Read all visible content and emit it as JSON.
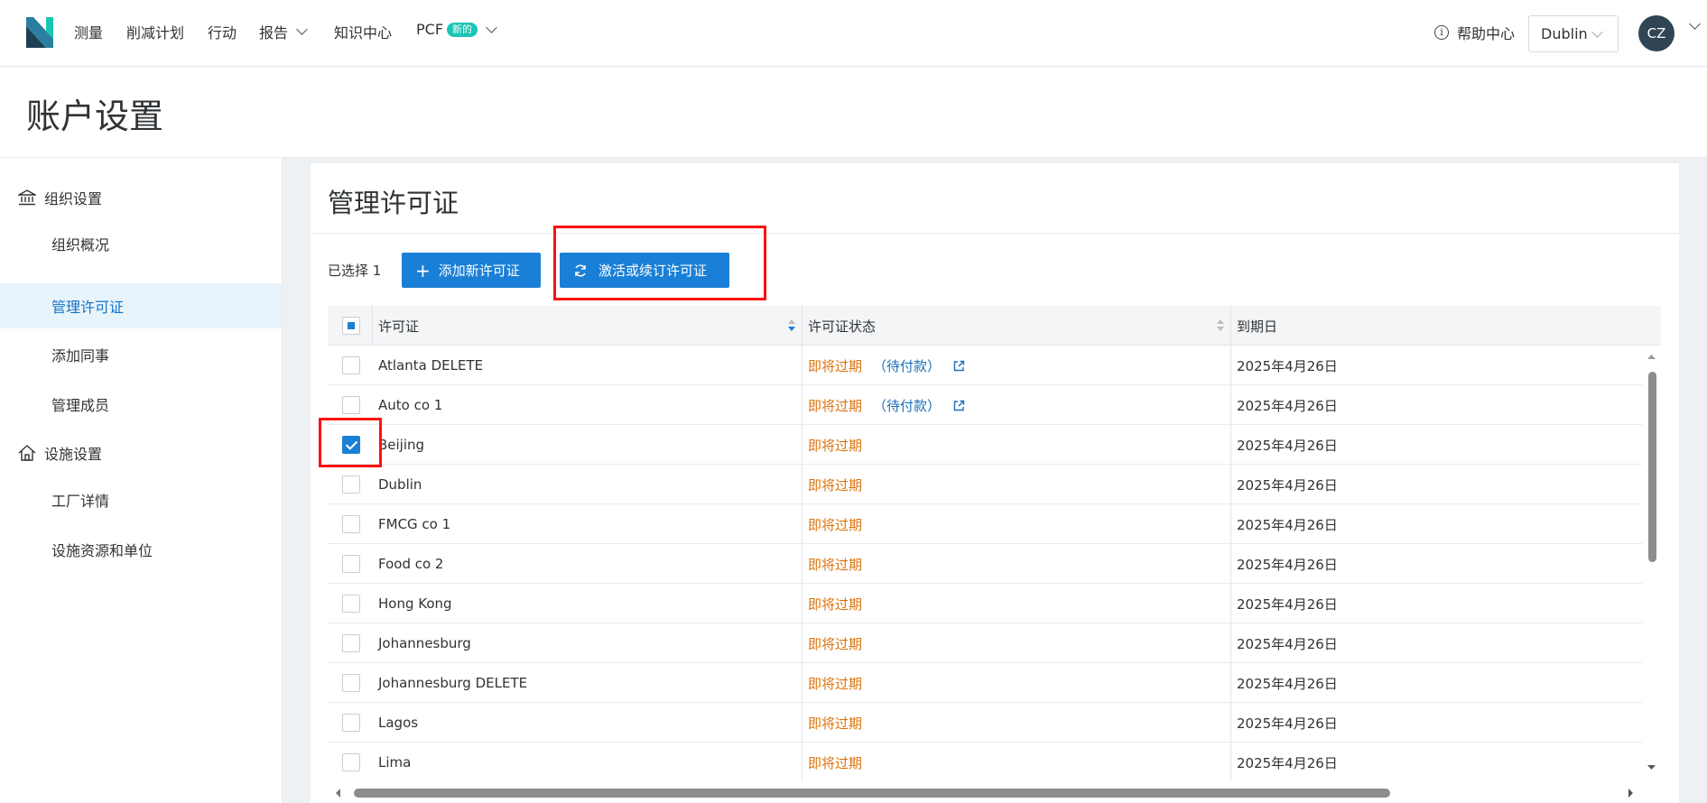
{
  "nav": {
    "items": [
      "测量",
      "削减计划",
      "行动",
      "报告",
      "知识中心",
      "PCF"
    ],
    "new_badge": "新的",
    "help": "帮助中心",
    "facility": "Dublin",
    "avatar": "CZ"
  },
  "page": {
    "title": "账户设置"
  },
  "sidebar": {
    "org_group": "组织设置",
    "org_items": [
      "组织概况",
      "管理许可证",
      "添加同事",
      "管理成员"
    ],
    "facility_group": "设施设置",
    "facility_items": [
      "工厂详情",
      "设施资源和单位"
    ],
    "active": "管理许可证"
  },
  "panel": {
    "title": "管理许可证",
    "selected_count": "已选择 1",
    "add_button": "添加新许可证",
    "activate_button": "激活或续订许可证"
  },
  "table": {
    "headers": [
      "许可证",
      "许可证状态",
      "到期日"
    ],
    "rows": [
      {
        "name": "Atlanta DELETE",
        "status": "即将过期",
        "pending": "（待付款）",
        "expiry": "2025年4月26日",
        "checked": false
      },
      {
        "name": "Auto co 1",
        "status": "即将过期",
        "pending": "（待付款）",
        "expiry": "2025年4月26日",
        "checked": false
      },
      {
        "name": "Beijing",
        "status": "即将过期",
        "pending": "",
        "expiry": "2025年4月26日",
        "checked": true
      },
      {
        "name": "Dublin",
        "status": "即将过期",
        "pending": "",
        "expiry": "2025年4月26日",
        "checked": false
      },
      {
        "name": "FMCG co 1",
        "status": "即将过期",
        "pending": "",
        "expiry": "2025年4月26日",
        "checked": false
      },
      {
        "name": "Food co 2",
        "status": "即将过期",
        "pending": "",
        "expiry": "2025年4月26日",
        "checked": false
      },
      {
        "name": "Hong Kong",
        "status": "即将过期",
        "pending": "",
        "expiry": "2025年4月26日",
        "checked": false
      },
      {
        "name": "Johannesburg",
        "status": "即将过期",
        "pending": "",
        "expiry": "2025年4月26日",
        "checked": false
      },
      {
        "name": "Johannesburg DELETE",
        "status": "即将过期",
        "pending": "",
        "expiry": "2025年4月26日",
        "checked": false
      },
      {
        "name": "Lagos",
        "status": "即将过期",
        "pending": "",
        "expiry": "2025年4月26日",
        "checked": false
      },
      {
        "name": "Lima",
        "status": "即将过期",
        "pending": "",
        "expiry": "2025年4月26日",
        "checked": false
      }
    ]
  },
  "colors": {
    "primary": "#1a7fd6",
    "warning": "#d9730d",
    "annotation": "#ff1010",
    "active_bg": "#e8f4fb"
  }
}
